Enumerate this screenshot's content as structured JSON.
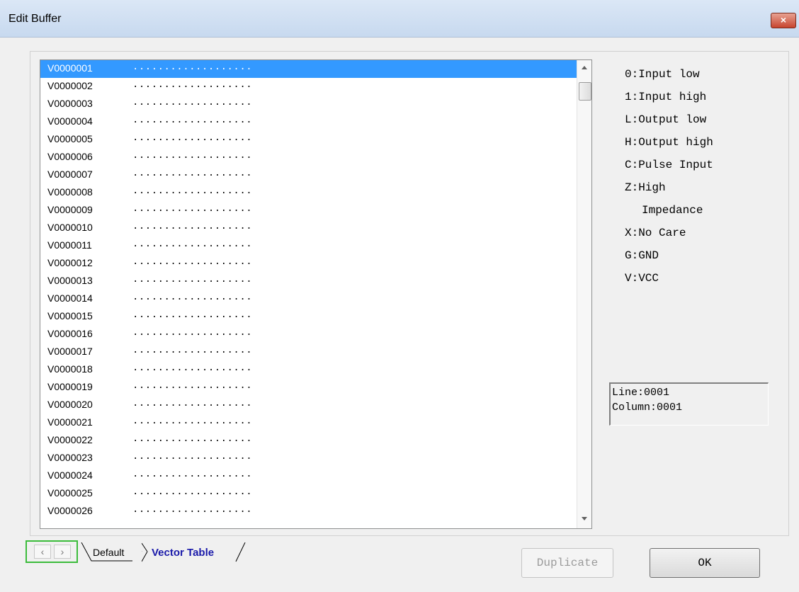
{
  "window": {
    "title": "Edit Buffer",
    "close_label": "×"
  },
  "buffer": {
    "rows": [
      {
        "addr": "V0000001",
        "vals": "..................."
      },
      {
        "addr": "V0000002",
        "vals": "..................."
      },
      {
        "addr": "V0000003",
        "vals": "..................."
      },
      {
        "addr": "V0000004",
        "vals": "..................."
      },
      {
        "addr": "V0000005",
        "vals": "..................."
      },
      {
        "addr": "V0000006",
        "vals": "..................."
      },
      {
        "addr": "V0000007",
        "vals": "..................."
      },
      {
        "addr": "V0000008",
        "vals": "..................."
      },
      {
        "addr": "V0000009",
        "vals": "..................."
      },
      {
        "addr": "V0000010",
        "vals": "..................."
      },
      {
        "addr": "V0000011",
        "vals": "..................."
      },
      {
        "addr": "V0000012",
        "vals": "..................."
      },
      {
        "addr": "V0000013",
        "vals": "..................."
      },
      {
        "addr": "V0000014",
        "vals": "..................."
      },
      {
        "addr": "V0000015",
        "vals": "..................."
      },
      {
        "addr": "V0000016",
        "vals": "..................."
      },
      {
        "addr": "V0000017",
        "vals": "..................."
      },
      {
        "addr": "V0000018",
        "vals": "..................."
      },
      {
        "addr": "V0000019",
        "vals": "..................."
      },
      {
        "addr": "V0000020",
        "vals": "..................."
      },
      {
        "addr": "V0000021",
        "vals": "..................."
      },
      {
        "addr": "V0000022",
        "vals": "..................."
      },
      {
        "addr": "V0000023",
        "vals": "..................."
      },
      {
        "addr": "V0000024",
        "vals": "..................."
      },
      {
        "addr": "V0000025",
        "vals": "..................."
      },
      {
        "addr": "V0000026",
        "vals": "..................."
      }
    ],
    "selected_row": 0
  },
  "legend": {
    "items": [
      "0:Input low",
      "1:Input high",
      "L:Output low",
      "H:Output high",
      "C:Pulse Input",
      "Z:High",
      "X:No Care",
      "G:GND",
      "V:VCC"
    ],
    "z_continuation": "Impedance"
  },
  "status": {
    "line": "Line:0001",
    "column": "Column:0001"
  },
  "tabs": {
    "prev": "‹",
    "next": "›",
    "default": "Default",
    "vector_table": "Vector Table"
  },
  "buttons": {
    "duplicate": "Duplicate",
    "ok": "OK"
  },
  "colors": {
    "selection": "#3399ff",
    "active_tab_text": "#1a1aaa",
    "tabnav_border": "#3cbc3c"
  }
}
